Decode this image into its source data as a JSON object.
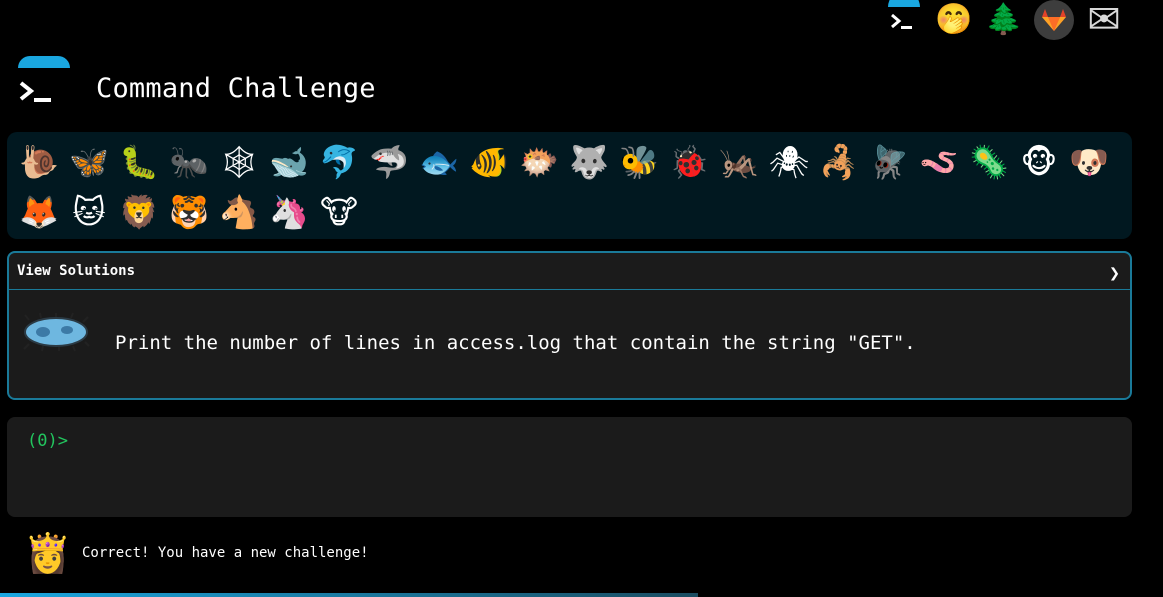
{
  "header": {
    "title": "Command Challenge"
  },
  "top_nav": {
    "icons": [
      "terminal-logo-icon",
      "shushing-face-icon",
      "tree-icon",
      "gitlab-icon",
      "mail-icon"
    ],
    "glyphs": {
      "shush": "🤭",
      "tree": "🌲",
      "mail": "✉"
    }
  },
  "badges": [
    {
      "name": "snail",
      "glyph": "🐌"
    },
    {
      "name": "butterfly",
      "glyph": "🦋"
    },
    {
      "name": "caterpillar",
      "glyph": "🐛"
    },
    {
      "name": "ant",
      "glyph": "🐜"
    },
    {
      "name": "spiderweb",
      "glyph": "🕸"
    },
    {
      "name": "whale",
      "glyph": "🐋"
    },
    {
      "name": "dolphin",
      "glyph": "🐬"
    },
    {
      "name": "shark",
      "glyph": "🦈"
    },
    {
      "name": "fish",
      "glyph": "🐟"
    },
    {
      "name": "tropical-fish",
      "glyph": "🐠"
    },
    {
      "name": "blowfish",
      "glyph": "🐡"
    },
    {
      "name": "wolf",
      "glyph": "🐺"
    },
    {
      "name": "bee",
      "glyph": "🐝"
    },
    {
      "name": "ladybug",
      "glyph": "🐞"
    },
    {
      "name": "cricket",
      "glyph": "🦗"
    },
    {
      "name": "spider",
      "glyph": "🕷"
    },
    {
      "name": "scorpion",
      "glyph": "🦂"
    },
    {
      "name": "fly",
      "glyph": "🪰"
    },
    {
      "name": "worm",
      "glyph": "🪱"
    },
    {
      "name": "microbe",
      "glyph": "🦠"
    },
    {
      "name": "monkey",
      "glyph": "🐵"
    },
    {
      "name": "dog",
      "glyph": "🐶"
    },
    {
      "name": "fox",
      "glyph": "🦊"
    },
    {
      "name": "cat",
      "glyph": "🐱"
    },
    {
      "name": "lion",
      "glyph": "🦁"
    },
    {
      "name": "tiger",
      "glyph": "🐯"
    },
    {
      "name": "horse",
      "glyph": "🐴"
    },
    {
      "name": "unicorn",
      "glyph": "🦄"
    },
    {
      "name": "cow",
      "glyph": "🐮"
    }
  ],
  "challenge": {
    "toggle_label": "View Solutions",
    "chevron": "❯",
    "text": "Print the number of lines in access.log that contain the string \"GET\".",
    "icon": "microbe-icon"
  },
  "terminal": {
    "prompt": "(0)>",
    "value": ""
  },
  "status": {
    "avatar": "👸",
    "message": "Correct! You have a new challenge!"
  },
  "progress": {
    "fraction": 0.6
  },
  "colors": {
    "accent": "#1aa7e0",
    "prompt": "#22c55e",
    "panel": "#1b1b1b",
    "border": "#1a7a99"
  }
}
